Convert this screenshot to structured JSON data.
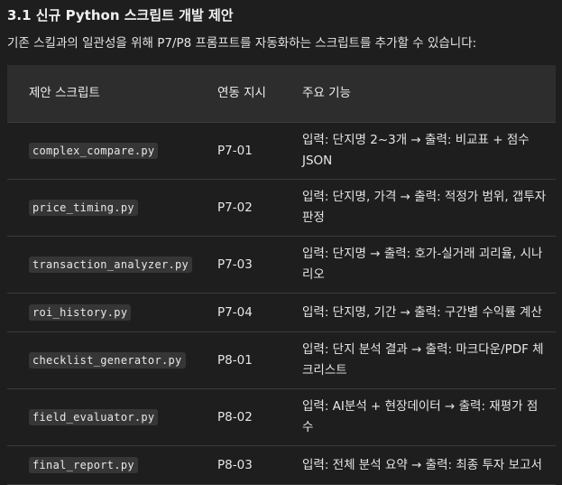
{
  "heading": "3.1 신규 Python 스크립트 개발 제안",
  "description": "기존 스킬과의 일관성을 위해 P7/P8 프롬프트를 자동화하는 스크립트를 추가할 수 있습니다:",
  "table": {
    "headers": [
      "제안 스크립트",
      "연동 지시",
      "주요 기능"
    ],
    "rows": [
      {
        "script": "complex_compare.py",
        "link": "P7-01",
        "feature": "입력: 단지명 2~3개 → 출력: 비교표 + 점수 JSON"
      },
      {
        "script": "price_timing.py",
        "link": "P7-02",
        "feature": "입력: 단지명, 가격 → 출력: 적정가 범위, 갭투자 판정"
      },
      {
        "script": "transaction_analyzer.py",
        "link": "P7-03",
        "feature": "입력: 단지명 → 출력: 호가-실거래 괴리율, 시나리오"
      },
      {
        "script": "roi_history.py",
        "link": "P7-04",
        "feature": "입력: 단지명, 기간 → 출력: 구간별 수익률 계산"
      },
      {
        "script": "checklist_generator.py",
        "link": "P8-01",
        "feature": "입력: 단지 분석 결과 → 출력: 마크다운/PDF 체크리스트"
      },
      {
        "script": "field_evaluator.py",
        "link": "P8-02",
        "feature": "입력: AI분석 + 현장데이터 → 출력: 재평가 점수"
      },
      {
        "script": "final_report.py",
        "link": "P8-03",
        "feature": "입력: 전체 분석 요약 → 출력: 최종 투자 보고서"
      }
    ]
  }
}
